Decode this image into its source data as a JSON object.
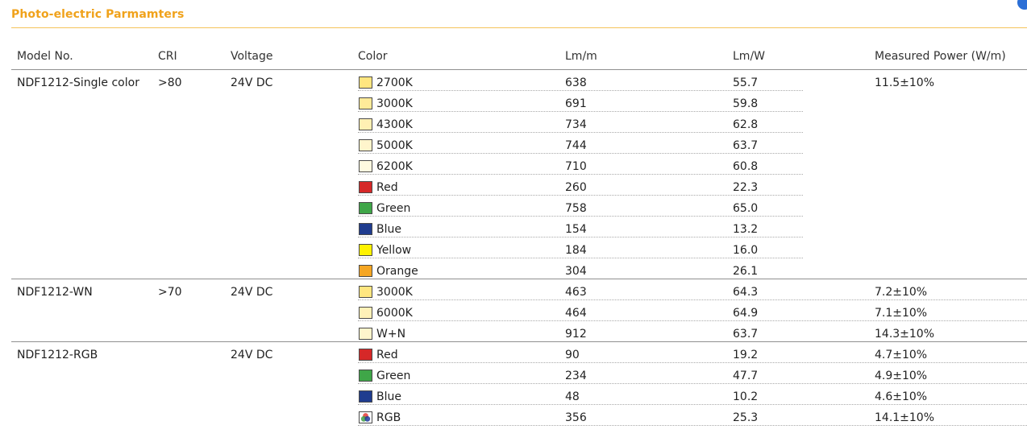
{
  "title": "Photo-electric Parmamters",
  "headers": {
    "model": "Model No.",
    "cri": "CRI",
    "voltage": "Voltage",
    "color": "Color",
    "lm_m": "Lm/m",
    "lm_w": "Lm/W",
    "power": "Measured Power (W/m)"
  },
  "groups": [
    {
      "model": "NDF1212-Single color",
      "cri": ">80",
      "voltage": "24V DC",
      "power": "11.5±10%",
      "rows": [
        {
          "color": "2700K",
          "swatch": "#ffe680",
          "lm_m": "638",
          "lm_w": "55.7"
        },
        {
          "color": "3000K",
          "swatch": "#ffeb99",
          "lm_m": "691",
          "lm_w": "59.8"
        },
        {
          "color": "4300K",
          "swatch": "#fff0b3",
          "lm_m": "734",
          "lm_w": "62.8"
        },
        {
          "color": "5000K",
          "swatch": "#fff5cc",
          "lm_m": "744",
          "lm_w": "63.7"
        },
        {
          "color": "6200K",
          "swatch": "#fffae0",
          "lm_m": "710",
          "lm_w": "60.8"
        },
        {
          "color": "Red",
          "swatch": "#d62828",
          "lm_m": "260",
          "lm_w": "22.3"
        },
        {
          "color": "Green",
          "swatch": "#3fa648",
          "lm_m": "758",
          "lm_w": "65.0"
        },
        {
          "color": "Blue",
          "swatch": "#1f3c8f",
          "lm_m": "154",
          "lm_w": "13.2"
        },
        {
          "color": "Yellow",
          "swatch": "#fff200",
          "lm_m": "184",
          "lm_w": "16.0"
        },
        {
          "color": "Orange",
          "swatch": "#f5a623",
          "lm_m": "304",
          "lm_w": "26.1"
        }
      ]
    },
    {
      "model": "NDF1212-WN",
      "cri": ">70",
      "voltage": "24V DC",
      "rows": [
        {
          "color": "3000K",
          "swatch": "#ffe680",
          "lm_m": "463",
          "lm_w": "64.3",
          "power": "7.2±10%"
        },
        {
          "color": "6000K",
          "swatch": "#fff1b8",
          "lm_m": "464",
          "lm_w": "64.9",
          "power": "7.1±10%"
        },
        {
          "color": "W+N",
          "swatch": "#fff5cc",
          "lm_m": "912",
          "lm_w": "63.7",
          "power": "14.3±10%"
        }
      ]
    },
    {
      "model": "NDF1212-RGB",
      "cri": "",
      "voltage": "24V DC",
      "rows": [
        {
          "color": "Red",
          "swatch": "#d62828",
          "lm_m": "90",
          "lm_w": "19.2",
          "power": "4.7±10%"
        },
        {
          "color": "Green",
          "swatch": "#3fa648",
          "lm_m": "234",
          "lm_w": "47.7",
          "power": "4.9±10%"
        },
        {
          "color": "Blue",
          "swatch": "#1f3c8f",
          "lm_m": "48",
          "lm_w": "10.2",
          "power": "4.6±10%"
        },
        {
          "color": "RGB",
          "swatch": "rgb-multi",
          "lm_m": "356",
          "lm_w": "25.3",
          "power": "14.1±10%"
        }
      ]
    }
  ]
}
